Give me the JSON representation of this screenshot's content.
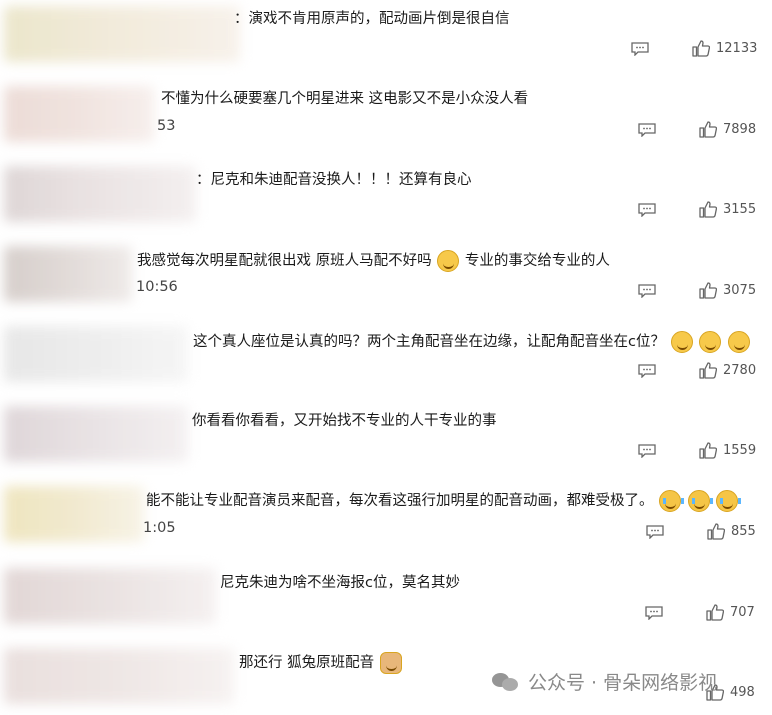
{
  "comments": [
    {
      "text": "：演戏不肯用原声的，配动画片倒是很自信",
      "stamp": "",
      "likes": "12133",
      "emojis": ""
    },
    {
      "text": "不懂为什么硬要塞几个明星进来 这电影又不是小众没人看",
      "stamp": "53",
      "likes": "7898",
      "emojis": ""
    },
    {
      "text": "：尼克和朱迪配音没换人！！！还算有良心",
      "stamp": "",
      "likes": "3155",
      "emojis": ""
    },
    {
      "text": "我感觉每次明星配就很出戏 原班人马配不好吗",
      "text2": "专业的事交给专业的人",
      "stamp": "10:56",
      "likes": "3075"
    },
    {
      "text": "这个真人座位是认真的吗？两个主角配音坐在边缘，让配角配音坐在c位？",
      "stamp": "",
      "likes": "2780"
    },
    {
      "text": "你看看你看看，又开始找不专业的人干专业的事",
      "stamp": "",
      "likes": "1559"
    },
    {
      "text": "能不能让专业配音演员来配音，每次看这强行加明星的配音动画，都难受极了。",
      "stamp": "1:05",
      "likes": "855"
    },
    {
      "text": "尼克朱迪为啥不坐海报c位，莫名其妙",
      "stamp": "",
      "likes": "707"
    },
    {
      "text": "那还行 狐兔原班配音",
      "stamp": "",
      "likes": "498"
    }
  ],
  "watermark": {
    "text": "公众号 · 骨朵网络影视"
  },
  "icons": {
    "reply": "comment-icon",
    "like": "thumbs-up-icon",
    "watermark": "wechat-logo-icon"
  },
  "colors": {
    "text": "#1a1a1a",
    "meta": "#555555",
    "watermark": "#7d7d7d"
  }
}
